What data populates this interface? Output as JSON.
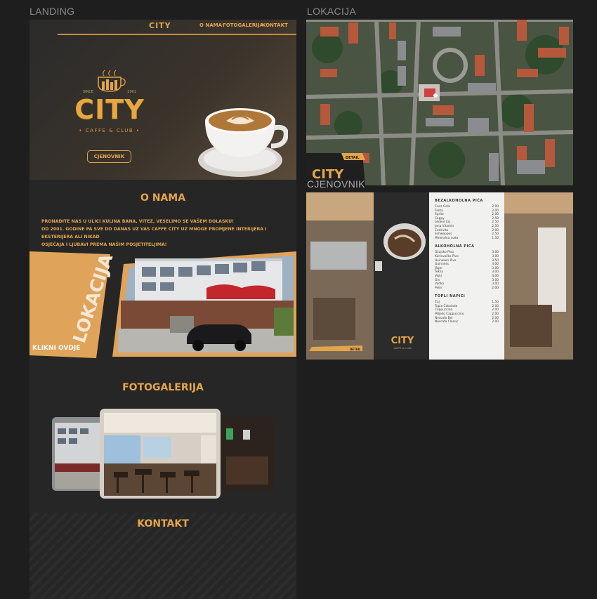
{
  "sections": {
    "landing_label": "LANDING",
    "lokacija_label": "LOKACIJA",
    "cjenovnik_label": "CJENOVNIK"
  },
  "nav": {
    "logo": "CITY",
    "items": [
      "O NAMA",
      "FOTOGALERIJA",
      "KONTAKT"
    ]
  },
  "hero": {
    "logo_since": "SINCE",
    "logo_year": "2001",
    "logo_name": "CITY",
    "logo_tagline": "• CAFFE & CLUB •",
    "button": "CJENOVNIK"
  },
  "onama": {
    "title": "O NAMA",
    "lines": [
      "PRONAĐITE NAS U ULICI KULINA BANA, VITEZ, VESELIMO SE VAŠEM DOLASKU!",
      "OD 2001. GODINE PA SVE DO DANAS UZ VAS CAFFE CITY UZ MNOGE PROMJENE INTERIJERA I EKSTERIJERA ALI NIKAD",
      "OSJEĆAJA I LJUBAVI PREMA NAŠIM POSJETITELJIMA!"
    ]
  },
  "lokacija_band": {
    "big": "LOKACIJA",
    "cta": "KLIKNI OVDJE"
  },
  "fotogalerija": {
    "title": "FOTOGALERIJA"
  },
  "kontakt": {
    "title": "KONTAKT"
  },
  "map_overlay": {
    "logo": "CITY",
    "tag": "DETAIL"
  },
  "menu": {
    "sections": [
      {
        "title": "BEZALKOHOLNA PIĆA",
        "items": [
          [
            "Coca Cola",
            "2.00"
          ],
          [
            "Fanta",
            "2.00"
          ],
          [
            "Sprite",
            "2.00"
          ],
          [
            "Cappy",
            "2.50"
          ],
          [
            "Ledeni čaj",
            "2.50"
          ],
          [
            "Jana Vitamin",
            "2.50"
          ],
          [
            "Cedevita",
            "2.00"
          ],
          [
            "Schweppes",
            "2.50"
          ],
          [
            "Mineralna voda",
            "1.50"
          ]
        ]
      },
      {
        "title": "ALKOHOLNA PIĆA",
        "items": [
          [
            "Ožujsko Pivo",
            "3.00"
          ],
          [
            "Karlovačko Pivo",
            "3.00"
          ],
          [
            "Heineken Pivo",
            "3.50"
          ],
          [
            "Guinness",
            "4.00"
          ],
          [
            "Jäger",
            "3.00"
          ],
          [
            "Tekila",
            "3.00"
          ],
          [
            "Viski",
            "4.00"
          ],
          [
            "Gin",
            "3.00"
          ],
          [
            "Vodka",
            "3.00"
          ],
          [
            "Pelin",
            "2.00"
          ]
        ]
      },
      {
        "title": "TOPLI NAPICI",
        "items": [
          [
            "Čaj",
            "1.50"
          ],
          [
            "Topla Čokolada",
            "2.00"
          ],
          [
            "Cappuccino",
            "2.00"
          ],
          [
            "Mlijeko Cappuccino",
            "2.00"
          ],
          [
            "Nescafe Bel",
            "2.00"
          ],
          [
            "Nescafe Classic",
            "2.00"
          ]
        ]
      }
    ],
    "photo_logo": "CITY",
    "photo_sub": "CAFFE & CLUB",
    "photo_tag": "DETAIL"
  },
  "colors": {
    "accent": "#e3a54a",
    "bg": "#1e1e1e",
    "panel": "#262626"
  }
}
